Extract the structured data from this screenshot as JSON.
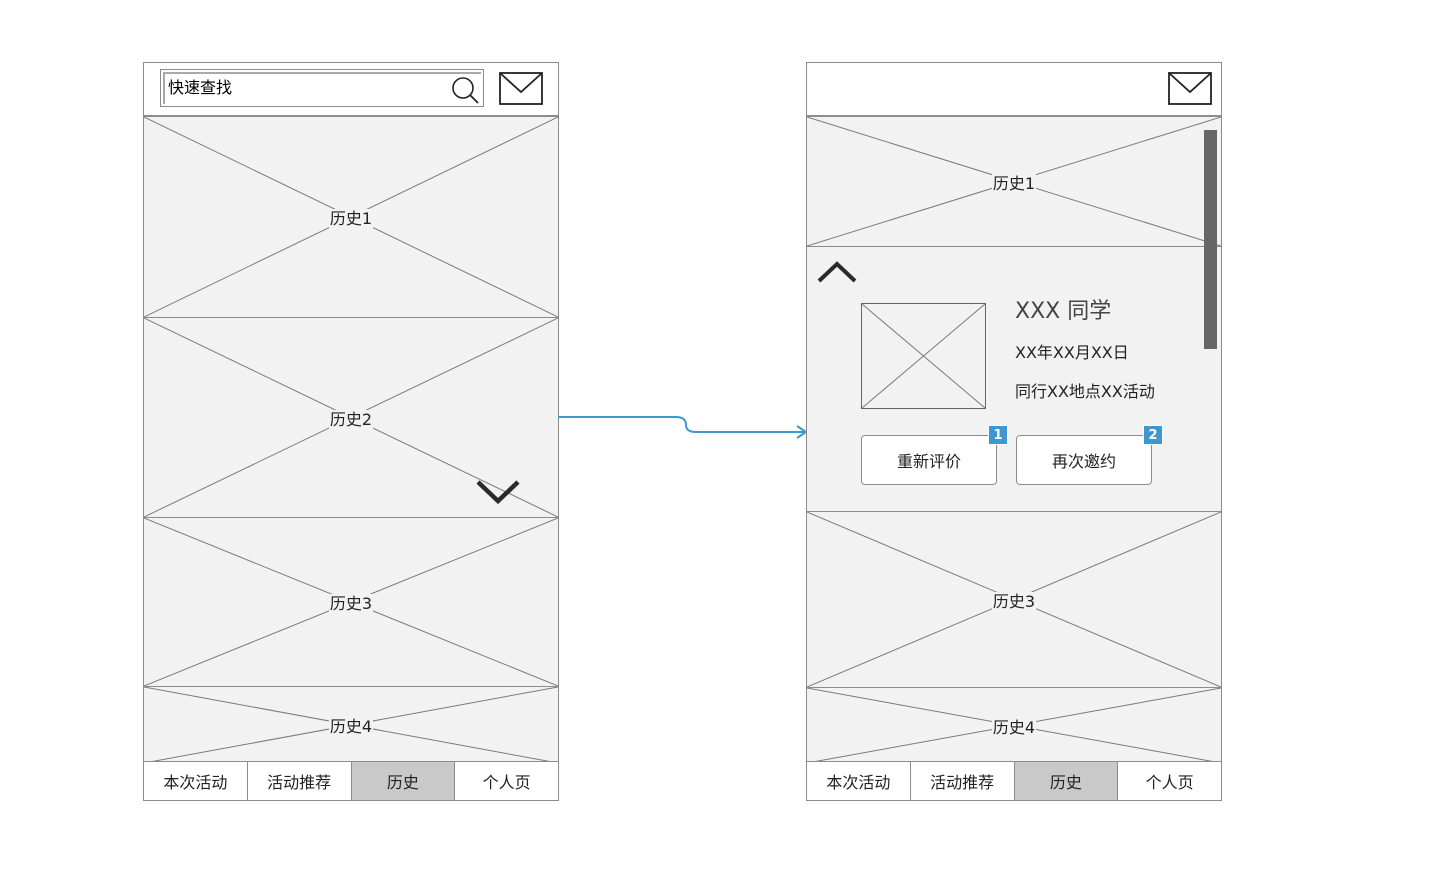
{
  "left_screen": {
    "search_placeholder": "快速查找",
    "items": [
      "历史1",
      "历史2",
      "历史3",
      "历史4"
    ]
  },
  "right_screen": {
    "items_top": [
      "历史1"
    ],
    "expanded": {
      "name": "XXX 同学",
      "date": "XX年XX月XX日",
      "activity": "同行XX地点XX活动",
      "buttons": [
        {
          "label": "重新评价",
          "badge": "1"
        },
        {
          "label": "再次邀约",
          "badge": "2"
        }
      ]
    },
    "items_bottom": [
      "历史3",
      "历史4"
    ]
  },
  "tabs": [
    "本次活动",
    "活动推荐",
    "历史",
    "个人页"
  ],
  "active_tab": "历史",
  "colors": {
    "accent": "#3f97d2",
    "placeholder_fill": "#f2f2f2",
    "active_tab": "#c9c9c9",
    "border": "#8c8c8c"
  }
}
